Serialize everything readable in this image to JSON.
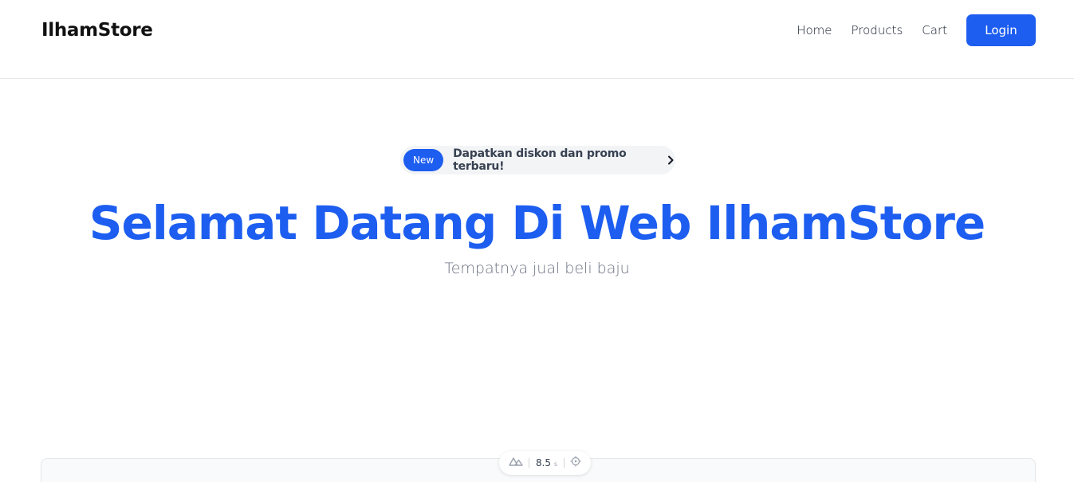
{
  "brand": {
    "name": "IlhamStore"
  },
  "nav": {
    "items": [
      {
        "label": "Home"
      },
      {
        "label": "Products"
      },
      {
        "label": "Cart"
      }
    ],
    "login_label": "Login"
  },
  "promo": {
    "badge": "New",
    "text": "Dapatkan diskon dan promo terbaru!"
  },
  "hero": {
    "title": "Selamat Datang Di Web IlhamStore",
    "subtitle": "Tempatnya jual beli baju"
  },
  "devtools": {
    "time_value": "8.5",
    "time_unit": "s"
  },
  "colors": {
    "accent": "#1d5ef0",
    "text": "#111827",
    "muted": "#6b7280",
    "promo_bg": "#f3f4f6"
  }
}
